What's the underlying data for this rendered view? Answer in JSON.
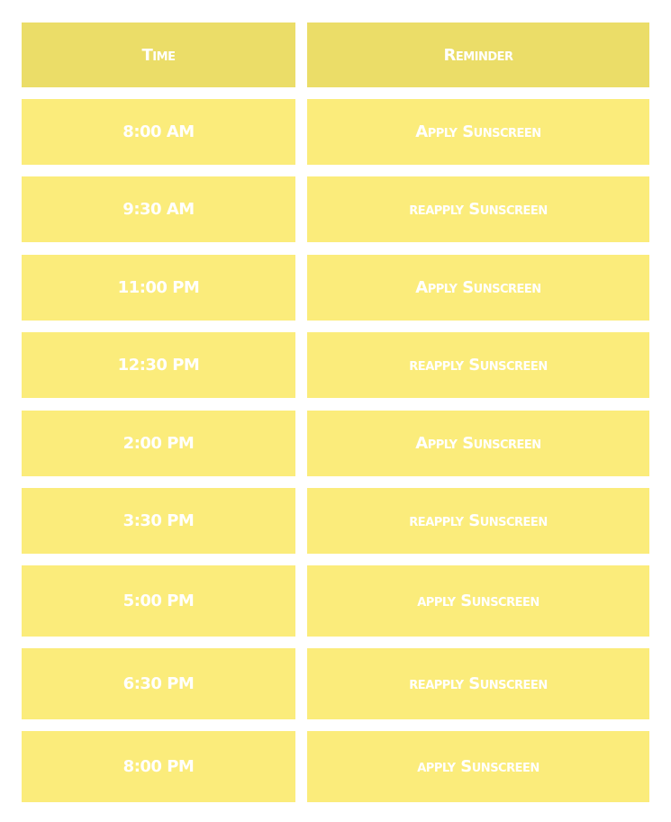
{
  "table": {
    "headers": {
      "time": "Time",
      "reminder": "Reminder"
    },
    "rows": [
      {
        "time": "8:00 AM",
        "reminder": "Apply Sunscreen"
      },
      {
        "time": "9:30 AM",
        "reminder": "reapply Sunscreen"
      },
      {
        "time": "11:00 PM",
        "reminder": "Apply Sunscreen"
      },
      {
        "time": "12:30 PM",
        "reminder": "reapply Sunscreen"
      },
      {
        "time": "2:00 PM",
        "reminder": "Apply Sunscreen"
      },
      {
        "time": "3:30 PM",
        "reminder": "reapply Sunscreen"
      },
      {
        "time": "5:00 PM",
        "reminder": "apply Sunscreen"
      },
      {
        "time": "6:30 PM",
        "reminder": "reapply Sunscreen"
      },
      {
        "time": "8:00 PM",
        "reminder": "apply Sunscreen"
      }
    ]
  },
  "colors": {
    "header_bg": "#ebdd68",
    "cell_bg": "#fbec7b",
    "text": "#ffffff"
  }
}
